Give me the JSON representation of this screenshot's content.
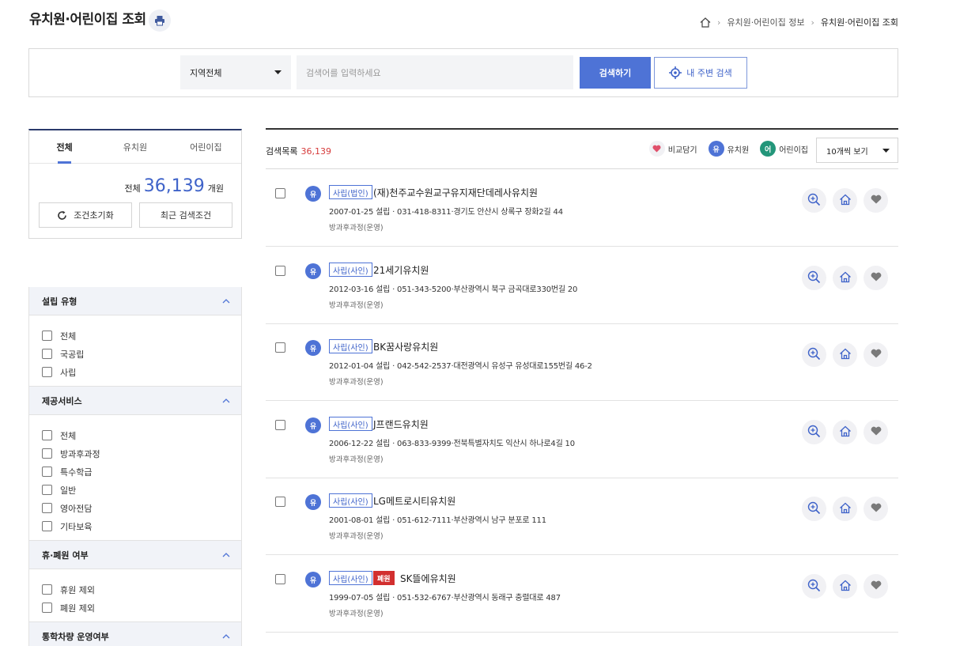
{
  "page": {
    "title": "유치원·어린이집 조회"
  },
  "breadcrumb": {
    "level1": "유치원·어린이집 정보",
    "current": "유치원·어린이집 조회"
  },
  "search": {
    "region": "지역전체",
    "placeholder": "검색어를 입력하세요",
    "search_label": "검색하기",
    "nearby_label": "내 주변 검색"
  },
  "tabs": [
    {
      "label": "전체",
      "active": true
    },
    {
      "label": "유치원",
      "active": false
    },
    {
      "label": "어린이집",
      "active": false
    }
  ],
  "summary": {
    "prefix": "전체",
    "count": "36,139",
    "suffix": "개원"
  },
  "buttons": {
    "reset": "조건초기화",
    "recent": "최근 검색조건"
  },
  "filters": [
    {
      "title": "설립 유형",
      "options": [
        "전체",
        "국공립",
        "사립"
      ]
    },
    {
      "title": "제공서비스",
      "options": [
        "전체",
        "방과후과정",
        "특수학급",
        "일반",
        "영아전담",
        "기타보육"
      ]
    },
    {
      "title": "휴·폐원 여부",
      "options": [
        "휴원 제외",
        "폐원 제외"
      ]
    },
    {
      "title": "통학차량 운영여부",
      "options": []
    }
  ],
  "list": {
    "title": "검색목록",
    "count": "36,139",
    "legend": {
      "compare": "비교담기",
      "kinder": "유치원",
      "kinder_mark": "유",
      "daycare": "어린이집",
      "daycare_mark": "어"
    },
    "per_page": "10개씩 보기"
  },
  "items": [
    {
      "type_mark": "유",
      "tag": "사립(법인)",
      "name": "(재)천주교수원교구유지재단데레사유치원",
      "info": "2007-01-25 설립 · 031-418-8311·경기도 안산시 상록구 장화2길 44",
      "service": "방과후과정(운영)",
      "closed": ""
    },
    {
      "type_mark": "유",
      "tag": "사립(사인)",
      "name": "21세기유치원",
      "info": "2012-03-16 설립 · 051-343-5200·부산광역시 북구 금곡대로330번길 20",
      "service": "방과후과정(운영)",
      "closed": ""
    },
    {
      "type_mark": "유",
      "tag": "사립(사인)",
      "name": "BK꿈사랑유치원",
      "info": "2012-01-04 설립 · 042-542-2537·대전광역시 유성구 유성대로155번길 46-2",
      "service": "방과후과정(운영)",
      "closed": ""
    },
    {
      "type_mark": "유",
      "tag": "사립(사인)",
      "name": "J프랜드유치원",
      "info": "2006-12-22 설립 · 063-833-9399·전북특별자치도 익산시 하나로4길 10",
      "service": "방과후과정(운영)",
      "closed": ""
    },
    {
      "type_mark": "유",
      "tag": "사립(사인)",
      "name": "LG메트로시티유치원",
      "info": "2001-08-01 설립 · 051-612-7111·부산광역시 남구 분포로 111",
      "service": "방과후과정(운영)",
      "closed": ""
    },
    {
      "type_mark": "유",
      "tag": "사립(사인)",
      "name": "SK뜰에유치원",
      "info": "1999-07-05 설립 · 051-532-6767·부산광역시 동래구 충렬대로 487",
      "service": "방과후과정(운영)",
      "closed": "폐원"
    }
  ]
}
